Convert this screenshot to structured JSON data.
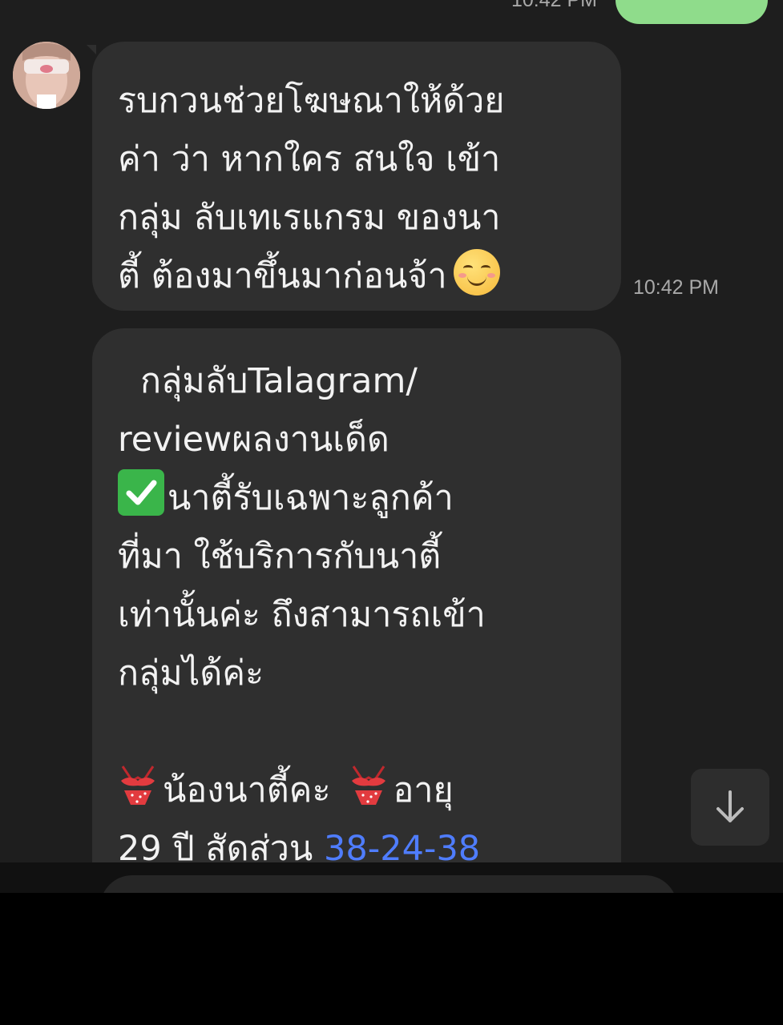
{
  "top_timestamp": "10:42 PM",
  "messages": {
    "first": {
      "lines": [
        "รบกวนช่วยโฆษณาให้ด้วย",
        "ค่า ว่า หากใคร สนใจ เข้า",
        "กลุ่ม ลับเทเรแกรม ของนา",
        "ตี้ ต้องมาขึ้นมาก่อนจ้า"
      ],
      "emoji": "smiling-face-icon",
      "timestamp": "10:42 PM"
    },
    "second": {
      "lines": [
        "กลุ่มลับTalagram/",
        "reviewผลงานเด็ด",
        "นาตี้รับเฉพาะลูกค้า",
        "ที่มา ใช้บริการกับนาตี้",
        "เท่านั้นค่ะ ถึงสามารถเข้า",
        "กลุ่มได้ค่ะ",
        "",
        "น้องนาตี้คะ",
        "อายุ",
        "29 ปี สัดส่วน",
        "38-24-38"
      ]
    }
  },
  "colors": {
    "background": "#1e1e1e",
    "bubble": "#2f2f2f",
    "outgoing_bubble": "#8fdc8b",
    "link": "#4f7dff",
    "timestamp": "#a9a9a9"
  },
  "icons": {
    "scroll_down": "arrow-down-icon",
    "check": "check-mark-button-icon",
    "bikini": "bikini-icon"
  }
}
